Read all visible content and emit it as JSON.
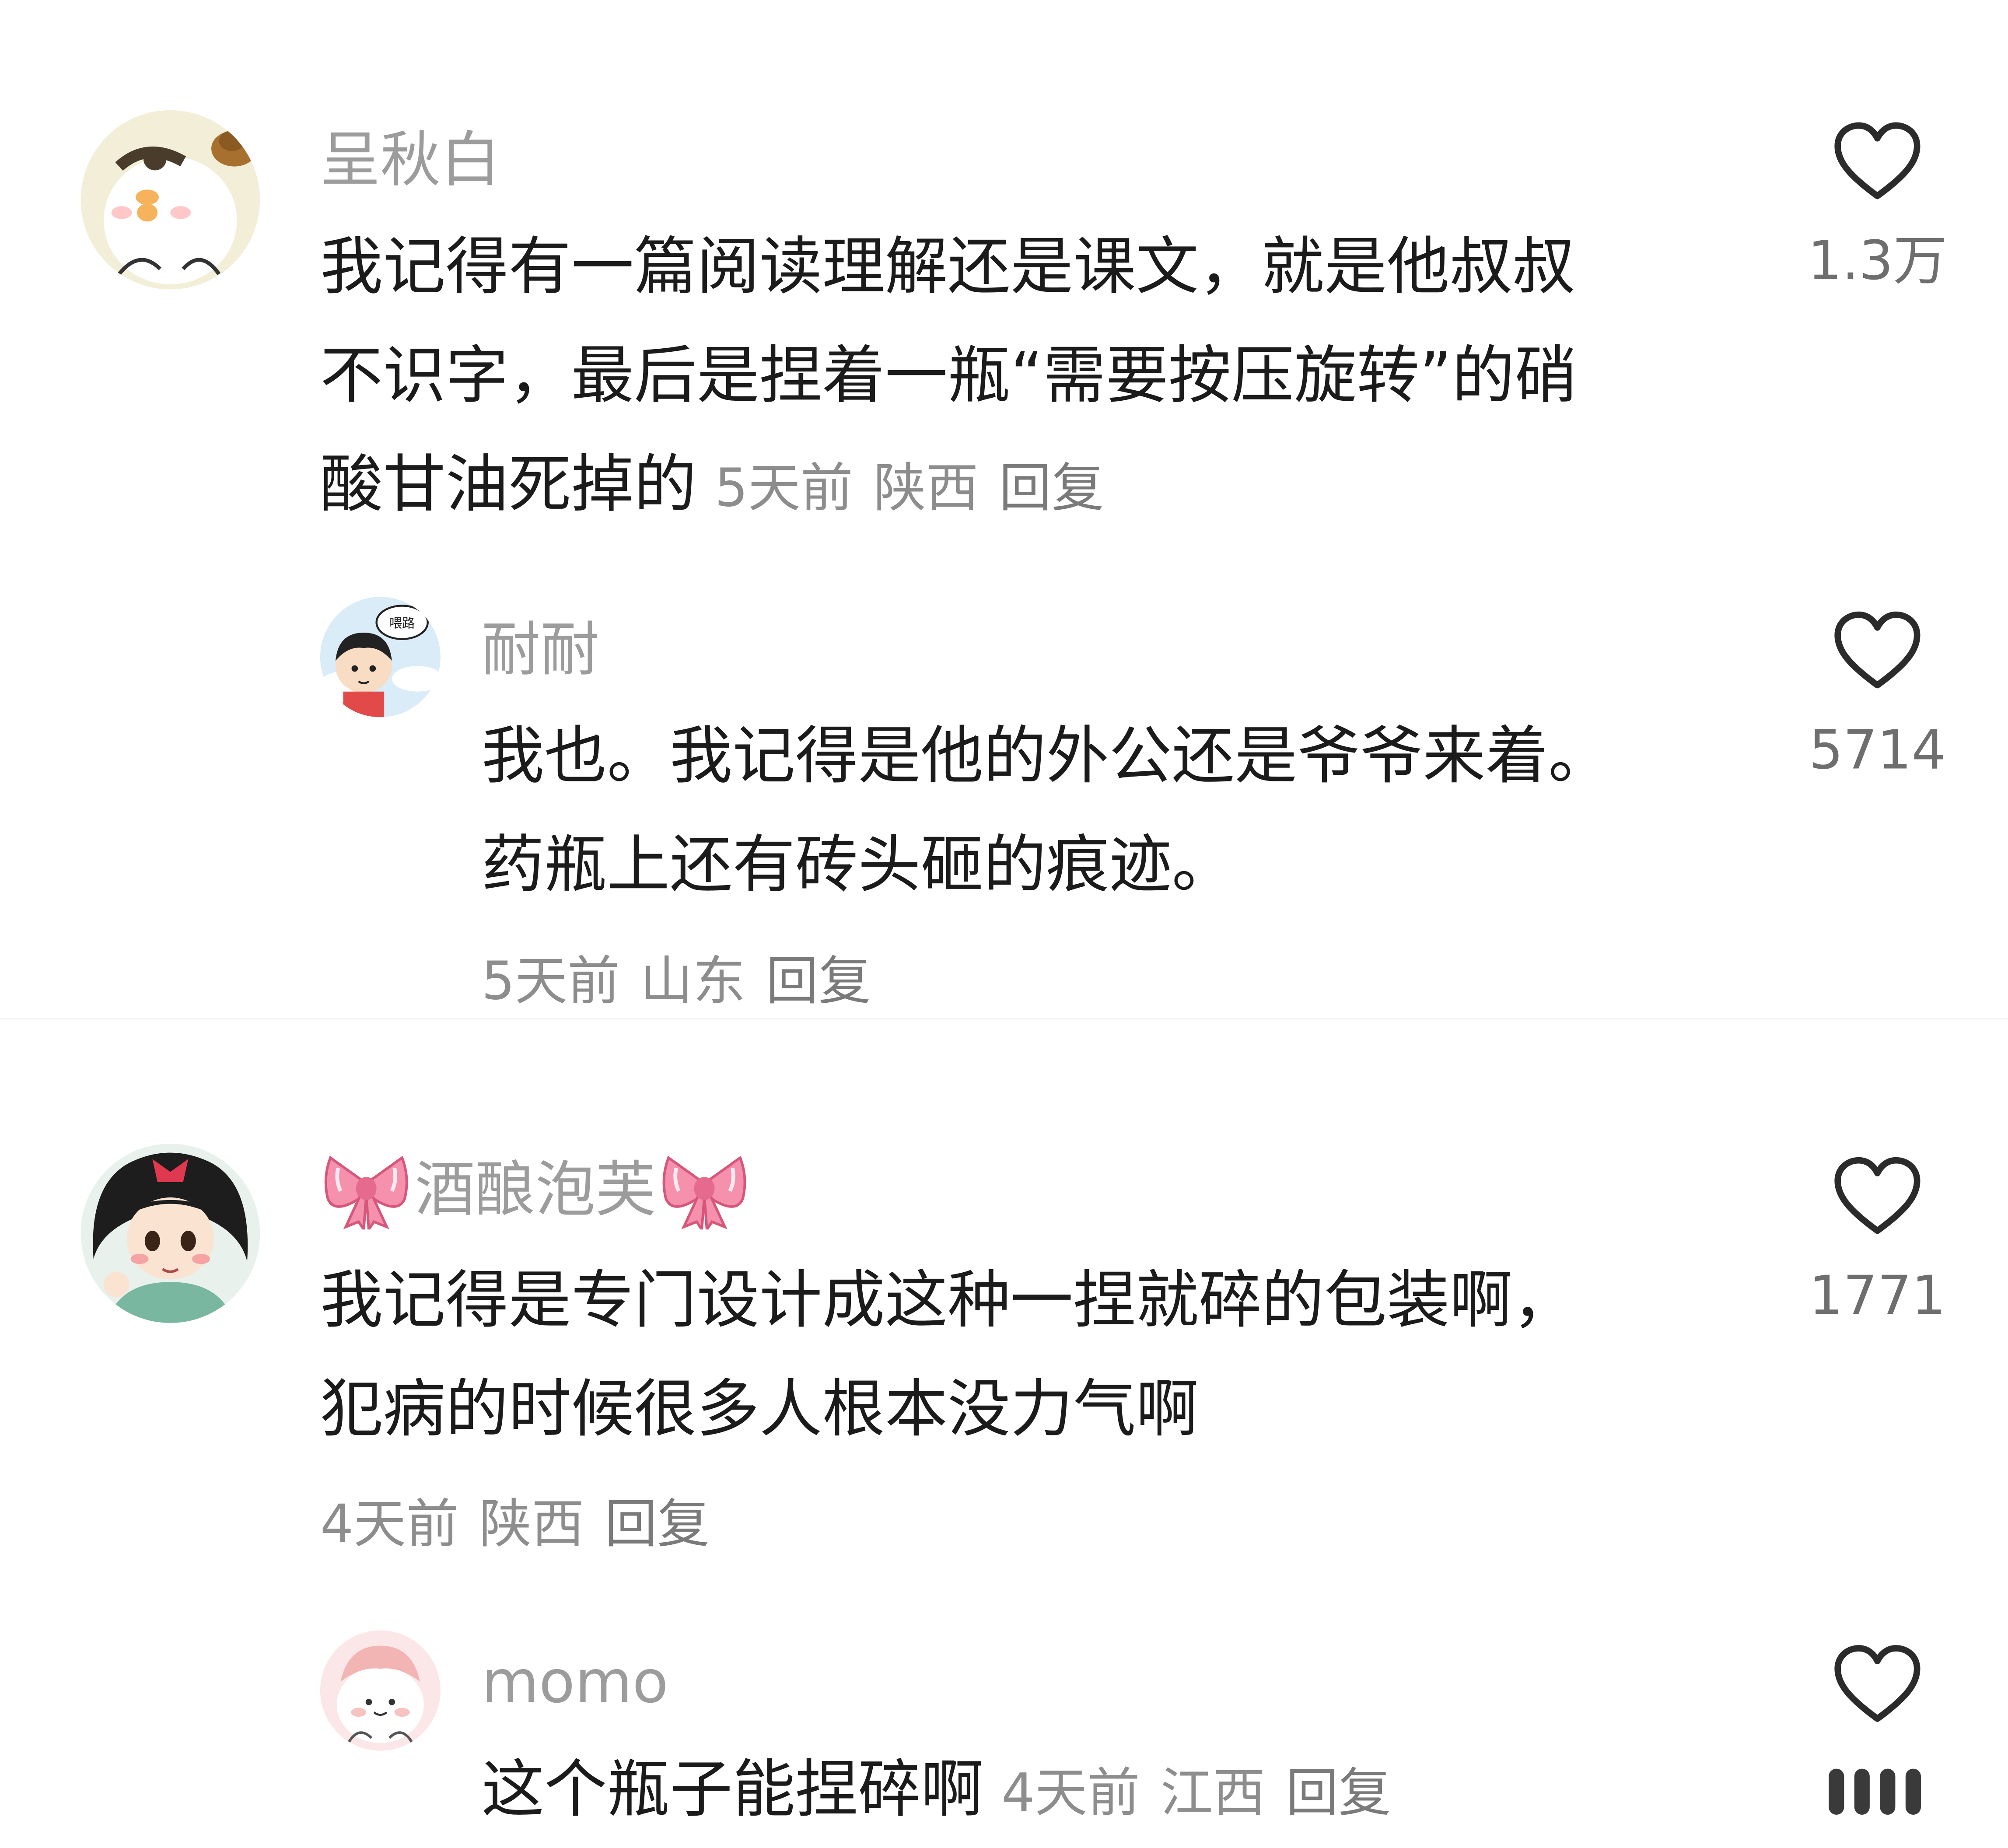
{
  "comments": [
    {
      "username": "呈秋白",
      "lines": [
        "我记得有一篇阅读理解还是课文，就是他叔叔",
        "不识字，最后是捏着一瓶“需要按压旋转”的硝",
        "酸甘油死掉的"
      ],
      "time": "5天前",
      "location": "陕西",
      "reply_label": "回复",
      "likes": "1.3万",
      "replies": [
        {
          "username": "耐耐",
          "lines": [
            "我也。我记得是他的外公还是爷爷来着。",
            "药瓶上还有砖头砸的痕迹。"
          ],
          "time": "5天前",
          "location": "山东",
          "reply_label": "回复",
          "likes": "5714",
          "avatar_badge": "喂路"
        }
      ]
    },
    {
      "username": "酒酿泡芙",
      "name_decor_icon": "bow-icon",
      "lines": [
        "我记得是专门设计成这种一捏就碎的包装啊，",
        "犯病的时候很多人根本没力气啊"
      ],
      "time": "4天前",
      "location": "陕西",
      "reply_label": "回复",
      "likes": "1771",
      "replies": [
        {
          "username": "momo",
          "lines": [
            "这个瓶子能捏碎啊"
          ],
          "time": "4天前",
          "location": "江西",
          "reply_label": "回复",
          "likes": ""
        }
      ]
    }
  ],
  "icons": {
    "like": "heart-outline-icon",
    "name_decor": "bow-icon"
  },
  "colors": {
    "username": "#9c9c9c",
    "body": "#1b1b1b",
    "meta": "#8d8d8d",
    "heart": "#2b2b2b",
    "bow": "#f08aa8"
  }
}
